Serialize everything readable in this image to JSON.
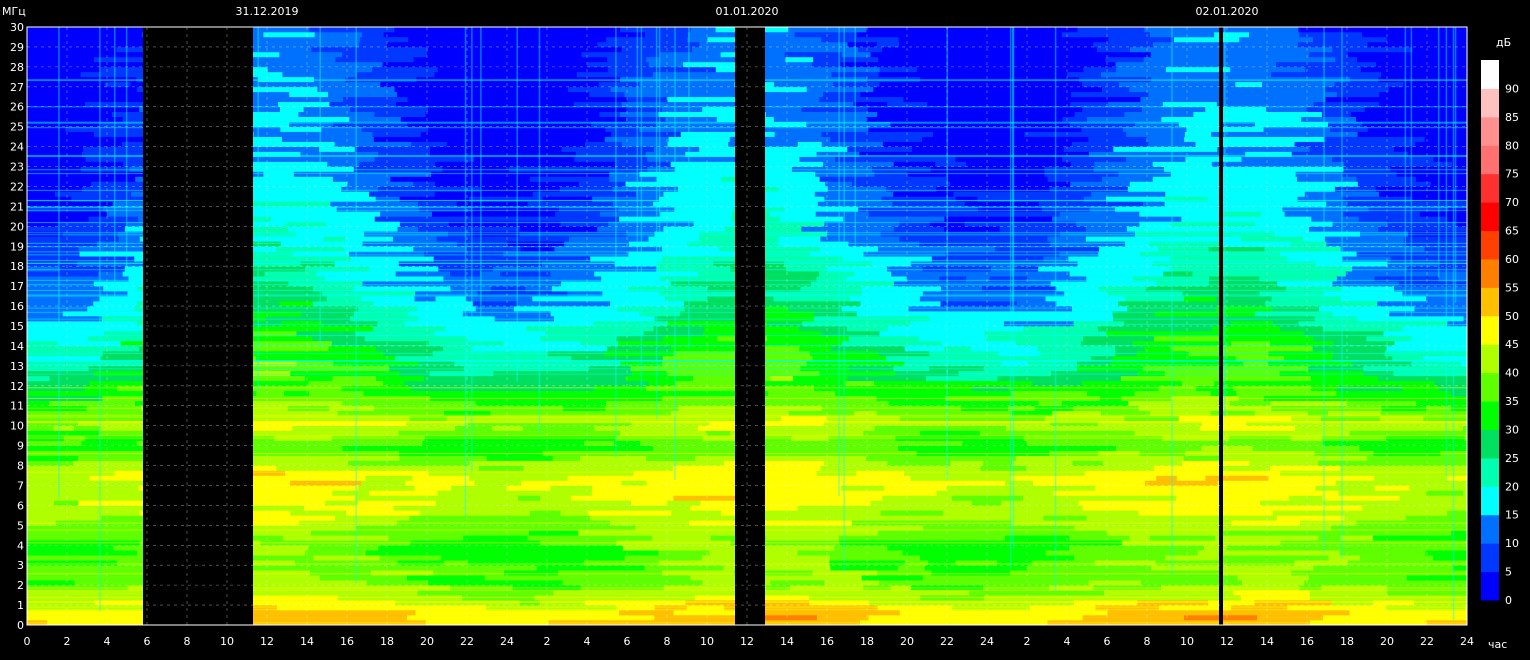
{
  "chart_data": {
    "type": "heatmap",
    "title": "",
    "ylabel": "МГц",
    "xlabel": "час",
    "colorbar_label": "дБ",
    "ylim": [
      0,
      30
    ],
    "y_ticks": [
      0,
      1,
      2,
      3,
      4,
      5,
      6,
      7,
      8,
      9,
      10,
      11,
      12,
      13,
      14,
      15,
      16,
      17,
      18,
      19,
      20,
      21,
      22,
      23,
      24,
      25,
      26,
      27,
      28,
      29,
      30
    ],
    "x_range_hours": [
      0,
      72
    ],
    "x_tick_labels": [
      "0",
      "2",
      "4",
      "6",
      "8",
      "10",
      "12",
      "14",
      "16",
      "18",
      "20",
      "22",
      "24",
      "2",
      "4",
      "6",
      "8",
      "10",
      "12",
      "14",
      "16",
      "18",
      "20",
      "22",
      "24",
      "2",
      "4",
      "6",
      "8",
      "10",
      "12",
      "14",
      "16",
      "18",
      "20",
      "22",
      "24"
    ],
    "date_labels": [
      {
        "text": "31.12.2019",
        "hour": 12
      },
      {
        "text": "01.01.2020",
        "hour": 36
      },
      {
        "text": "02.01.2020",
        "hour": 60
      }
    ],
    "data_gaps_hours": [
      [
        5.8,
        11.3
      ],
      [
        35.4,
        36.9
      ],
      [
        59.6,
        59.8
      ]
    ],
    "colorbar": {
      "ticks": [
        0,
        5,
        10,
        15,
        20,
        25,
        30,
        35,
        40,
        45,
        50,
        55,
        60,
        65,
        70,
        75,
        80,
        85,
        90
      ],
      "colors": [
        "#0000ff",
        "#0038ff",
        "#0070ff",
        "#00ffff",
        "#00ffb0",
        "#00e060",
        "#00ff00",
        "#60ff00",
        "#b0ff00",
        "#ffff00",
        "#ffc000",
        "#ff8000",
        "#ff4000",
        "#ff0000",
        "#ff3030",
        "#ff7070",
        "#ff9090",
        "#ffc0c0",
        "#ffffff"
      ]
    },
    "intensity_profile_db_by_mhz": [
      {
        "mhz": 0.5,
        "db": 48
      },
      {
        "mhz": 2,
        "db": 36
      },
      {
        "mhz": 4,
        "db": 34
      },
      {
        "mhz": 6,
        "db": 42
      },
      {
        "mhz": 7.5,
        "db": 44
      },
      {
        "mhz": 9,
        "db": 32
      },
      {
        "mhz": 10,
        "db": 40
      },
      {
        "mhz": 12,
        "db": 30
      },
      {
        "mhz": 14,
        "db": 25
      },
      {
        "mhz": 16,
        "db": 18
      },
      {
        "mhz": 18,
        "db": 14
      },
      {
        "mhz": 20,
        "db": 10
      },
      {
        "mhz": 24,
        "db": 6
      },
      {
        "mhz": 30,
        "db": 3
      }
    ],
    "grid": true
  }
}
